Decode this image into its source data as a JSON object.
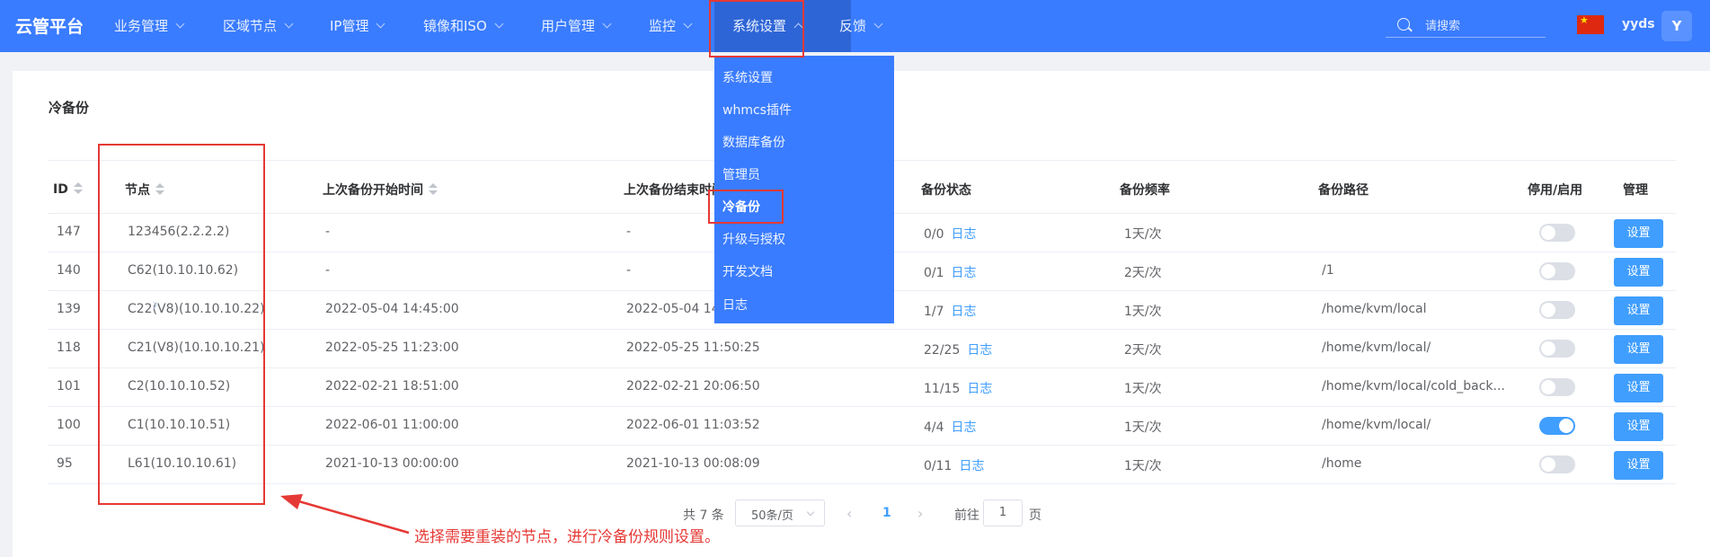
{
  "app": {
    "title": "云管平台"
  },
  "nav": {
    "items": [
      {
        "label": "业务管理"
      },
      {
        "label": "区域节点"
      },
      {
        "label": "IP管理"
      },
      {
        "label": "镜像和ISO"
      },
      {
        "label": "用户管理"
      },
      {
        "label": "监控"
      },
      {
        "label": "系统设置"
      },
      {
        "label": "反馈"
      }
    ],
    "active_item": "系统设置",
    "search_placeholder": "请搜索",
    "username": "yyds",
    "avatar_initial": "Y"
  },
  "dropdown": {
    "items": [
      {
        "label": "系统设置"
      },
      {
        "label": "whmcs插件"
      },
      {
        "label": "数据库备份"
      },
      {
        "label": "管理员"
      },
      {
        "label": "冷备份"
      },
      {
        "label": "升级与授权"
      },
      {
        "label": "开发文档"
      },
      {
        "label": "日志"
      }
    ],
    "highlighted_item": "冷备份"
  },
  "page": {
    "title": "冷备份"
  },
  "table": {
    "columns": [
      "ID",
      "节点",
      "上次备份开始时间",
      "上次备份结束时间",
      "备份状态",
      "备份频率",
      "备份路径",
      "停用/启用",
      "管理"
    ],
    "log_label": "日志",
    "action_label": "设置",
    "rows": [
      {
        "id": "147",
        "node": "123456(2.2.2.2)",
        "start": "-",
        "end": "-",
        "status": "0/0",
        "freq": "1天/次",
        "path": "",
        "enabled": false
      },
      {
        "id": "140",
        "node": "C62(10.10.10.62)",
        "start": "-",
        "end": "-",
        "status": "0/1",
        "freq": "2天/次",
        "path": "/1",
        "enabled": false
      },
      {
        "id": "139",
        "node": "C22(V8)(10.10.10.22)",
        "start": "2022-05-04 14:45:00",
        "end": "2022-05-04 14",
        "status": "1/7",
        "freq": "1天/次",
        "path": "/home/kvm/local",
        "enabled": false
      },
      {
        "id": "118",
        "node": "C21(V8)(10.10.10.21)",
        "start": "2022-05-25 11:23:00",
        "end": "2022-05-25 11:50:25",
        "status": "22/25",
        "freq": "2天/次",
        "path": "/home/kvm/local/",
        "enabled": false
      },
      {
        "id": "101",
        "node": "C2(10.10.10.52)",
        "start": "2022-02-21 18:51:00",
        "end": "2022-02-21 20:06:50",
        "status": "11/15",
        "freq": "1天/次",
        "path": "/home/kvm/local/cold_back...",
        "enabled": false
      },
      {
        "id": "100",
        "node": "C1(10.10.10.51)",
        "start": "2022-06-01 11:00:00",
        "end": "2022-06-01 11:03:52",
        "status": "4/4",
        "freq": "1天/次",
        "path": "/home/kvm/local/",
        "enabled": true
      },
      {
        "id": "95",
        "node": "L61(10.10.10.61)",
        "start": "2021-10-13 00:00:00",
        "end": "2021-10-13 00:08:09",
        "status": "0/11",
        "freq": "1天/次",
        "path": "/home",
        "enabled": false
      }
    ]
  },
  "pagination": {
    "total": "共 7 条",
    "page_size": "50条/页",
    "current_page": "1",
    "goto_label": "前往",
    "goto_value": "1",
    "page_unit": "页"
  },
  "annotation": {
    "text": "选择需要重装的节点，进行冷备份规则设置。",
    "color": "#e53935"
  },
  "colors": {
    "topbar": "#3a7cff",
    "accent": "#409eff"
  }
}
